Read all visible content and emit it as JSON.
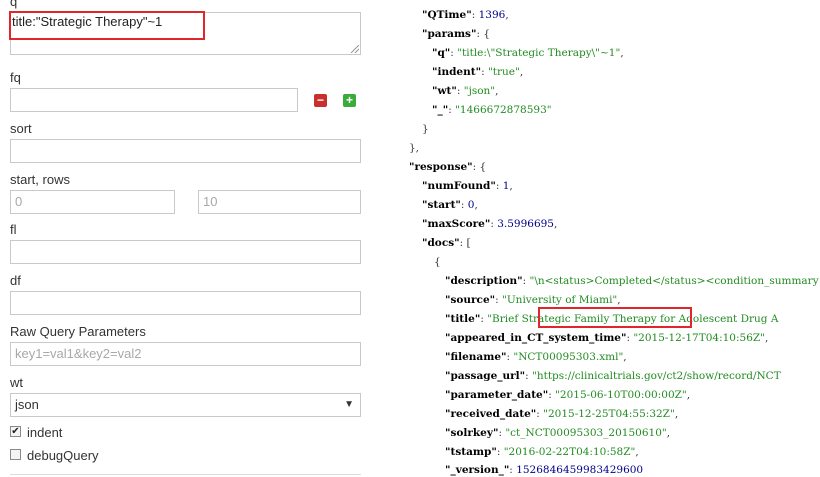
{
  "form": {
    "q_label": "q",
    "q_value": "title:\"Strategic Therapy\"~1",
    "fq_label": "fq",
    "sort_label": "sort",
    "start_rows_label": "start, rows",
    "start_value": "0",
    "rows_value": "10",
    "fl_label": "fl",
    "df_label": "df",
    "raw_label": "Raw Query Parameters",
    "raw_placeholder": "key1=val1&key2=val2",
    "wt_label": "wt",
    "wt_value": "json",
    "indent_label": "indent",
    "indent_checked": true,
    "debug_label": "debugQuery",
    "debug_checked": false
  },
  "response_json": {
    "qtime_key": "\"QTime\"",
    "qtime_value": "1396",
    "params_key": "\"params\"",
    "q_key": "\"q\"",
    "q_value": "\"title:\\\"Strategic Therapy\\\"~1\"",
    "indent_key": "\"indent\"",
    "indent_value": "\"true\"",
    "wt_key": "\"wt\"",
    "wt_value": "\"json\"",
    "underscore_key": "\"_\"",
    "underscore_value": "\"1466672878593\"",
    "response_key": "\"response\"",
    "numfound_key": "\"numFound\"",
    "numfound_value": "1",
    "start_key": "\"start\"",
    "start_value": "0",
    "maxscore_key": "\"maxScore\"",
    "maxscore_value": "3.5996695",
    "docs_key": "\"docs\"",
    "description_key": "\"description\"",
    "description_value": "\"\\n<status>Completed</status><condition_summary",
    "source_key": "\"source\"",
    "source_value": "\"University of Miami\"",
    "title_key": "\"title\"",
    "title_value_1": "\"Brief ",
    "title_value_2": "Strategic Family Therapy",
    "title_value_3": " for Adolescent Drug A",
    "appeared_key": "\"appeared_in_CT_system_time\"",
    "appeared_value": "\"2015-12-17T04:10:56Z\"",
    "filename_key": "\"filename\"",
    "filename_value": "\"NCT00095303.xml\"",
    "passage_key": "\"passage_url\"",
    "passage_value": "\"https://clinicaltrials.gov/ct2/show/record/NCT",
    "paramdate_key": "\"parameter_date\"",
    "paramdate_value": "\"2015-06-10T00:00:00Z\"",
    "received_key": "\"received_date\"",
    "received_value": "\"2015-12-25T04:55:32Z\"",
    "solrkey_key": "\"solrkey\"",
    "solrkey_value": "\"ct_NCT00095303_20150610\"",
    "tstamp_key": "\"tstamp\"",
    "tstamp_value": "\"2016-02-22T04:10:58Z\"",
    "version_key": "\"_version_\"",
    "version_value": "1526846459983429600"
  },
  "colors": {
    "highlight": "#e0262b",
    "remove_button": "#c9302c",
    "add_button": "#3bab3b",
    "json_string": "#228b22",
    "json_number": "#00008b"
  }
}
